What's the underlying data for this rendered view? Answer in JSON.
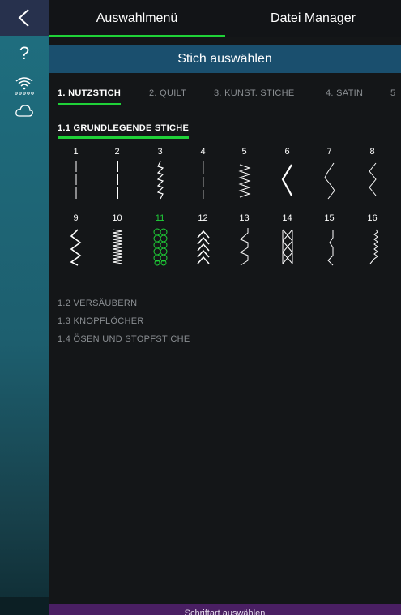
{
  "header": {
    "tabs": [
      {
        "label": "Auswahlmenü",
        "active": true
      },
      {
        "label": "Datei Manager",
        "active": false
      }
    ],
    "title": "Stich auswählen"
  },
  "sidebar": {
    "items": [
      {
        "icon": "back-arrow-icon"
      },
      {
        "icon": "help-icon",
        "label": "?"
      },
      {
        "icon": "wifi-icon"
      },
      {
        "icon": "cloud-icon"
      }
    ]
  },
  "category_tabs": [
    {
      "label": "1. NUTZSTICH",
      "active": true
    },
    {
      "label": "2. QUILT",
      "active": false
    },
    {
      "label": "3. KUNST. STICHE",
      "active": false
    },
    {
      "label": "4. SATIN",
      "active": false
    },
    {
      "label": "5",
      "active": false
    }
  ],
  "sections": [
    {
      "label": "1.1 GRUNDLEGENDE STICHE",
      "expanded": true
    },
    {
      "label": "1.2 VERSÄUBERN",
      "expanded": false
    },
    {
      "label": "1.3 KNOPFLÖCHER",
      "expanded": false
    },
    {
      "label": "1.4 ÖSEN UND STOPFSTICHE",
      "expanded": false
    }
  ],
  "stitches": [
    {
      "num": "1",
      "type": "straight-left"
    },
    {
      "num": "2",
      "type": "straight-center-bold"
    },
    {
      "num": "3",
      "type": "stretch-straight"
    },
    {
      "num": "4",
      "type": "straight-left-thin"
    },
    {
      "num": "5",
      "type": "zigzag-fine"
    },
    {
      "num": "6",
      "type": "zigzag-wide"
    },
    {
      "num": "7",
      "type": "zigzag-3step"
    },
    {
      "num": "8",
      "type": "zigzag-3step-narrow"
    },
    {
      "num": "9",
      "type": "zigzag-variable"
    },
    {
      "num": "10",
      "type": "satin-dense"
    },
    {
      "num": "11",
      "type": "honeycomb"
    },
    {
      "num": "12",
      "type": "chevron"
    },
    {
      "num": "13",
      "type": "overlock"
    },
    {
      "num": "14",
      "type": "cross-stitch"
    },
    {
      "num": "15",
      "type": "blind-hem"
    },
    {
      "num": "16",
      "type": "elastic-blind"
    }
  ],
  "selected_stitch": "11",
  "bottom_bar": {
    "label": "Schriftart auswählen"
  },
  "colors": {
    "accent": "#1fd238",
    "title_bar": "#1a4f6e",
    "sidebar": "#1f6f80",
    "bottom_bar": "#4a1f63"
  }
}
